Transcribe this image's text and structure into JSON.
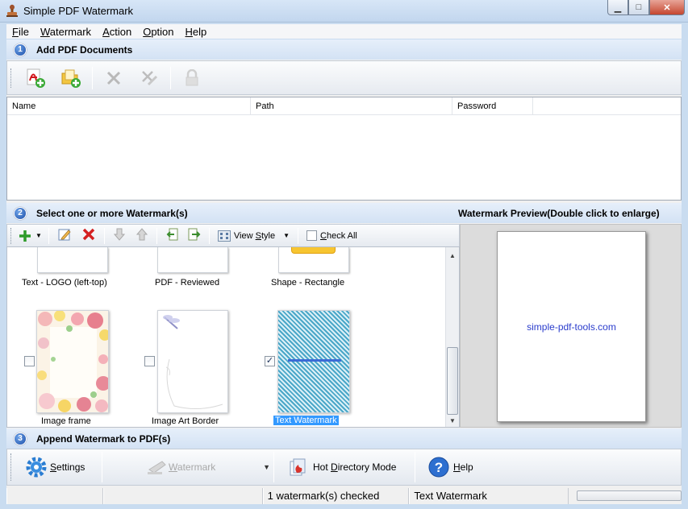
{
  "window": {
    "title": "Simple PDF Watermark",
    "min_glyph": "▁",
    "max_glyph": "□",
    "close_glyph": "✕"
  },
  "menu": [
    {
      "mnemonic": "F",
      "rest": "ile"
    },
    {
      "mnemonic": "W",
      "rest": "atermark"
    },
    {
      "mnemonic": "A",
      "rest": "ction"
    },
    {
      "mnemonic": "O",
      "rest": "ption"
    },
    {
      "mnemonic": "H",
      "rest": "elp"
    }
  ],
  "steps": {
    "one": {
      "number": "1",
      "title": "Add PDF Documents"
    },
    "two": {
      "number": "2",
      "title": "Select one or more Watermark(s)"
    },
    "three": {
      "number": "3",
      "title": "Append Watermark to PDF(s)"
    }
  },
  "file_table": {
    "columns": [
      "Name",
      "Path",
      "Password"
    ],
    "rows": []
  },
  "wm_toolbar": {
    "view_style_prefix": "View ",
    "view_style_mnemonic": "S",
    "view_style_rest": "tyle",
    "check_all_prefix": "",
    "check_all_mnemonic": "C",
    "check_all_rest": "heck All",
    "check_all_checked": false
  },
  "watermarks": {
    "row1": [
      {
        "label": "Text - LOGO (left-top)"
      },
      {
        "label": "PDF - Reviewed"
      },
      {
        "label": "Shape - Rectangle"
      }
    ],
    "row2": [
      {
        "label": "Image frame",
        "checked": false
      },
      {
        "label": "Image Art Border",
        "checked": false
      },
      {
        "label": "Text Watermark",
        "checked": true,
        "selected": true
      }
    ],
    "check_glyph": "✓"
  },
  "preview": {
    "title": "Watermark Preview(Double click to enlarge)",
    "text": "simple-pdf-tools.com",
    "text_color": "#2a3ccc"
  },
  "bottom": {
    "settings": {
      "mnemonic": "S",
      "rest": "ettings"
    },
    "watermark": {
      "mnemonic": "W",
      "rest": "atermark"
    },
    "hot_dir": {
      "prefix": "Hot ",
      "mnemonic": "D",
      "rest": "irectory Mode"
    },
    "help": {
      "mnemonic": "H",
      "rest": "elp"
    }
  },
  "status": {
    "checked_text": "1 watermark(s) checked",
    "current_text": "Text Watermark"
  },
  "colors": {
    "selection": "#3399ff",
    "header_bg": "#d3e2f4",
    "accent": "#1c4fa8"
  }
}
